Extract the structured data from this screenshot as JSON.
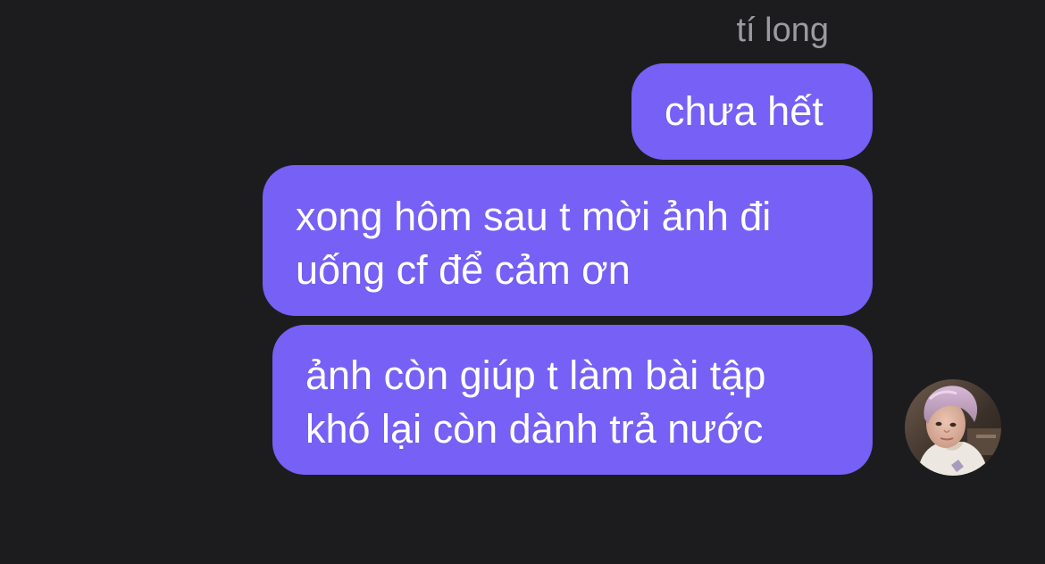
{
  "thread": {
    "sender_name": "tí long",
    "messages": [
      {
        "lines": [
          "chưa hết"
        ]
      },
      {
        "lines": [
          "xong hôm sau t mời ảnh đi",
          "uống cf để cảm ơn"
        ]
      },
      {
        "lines": [
          "ảnh còn giúp t làm bài tập",
          "khó lại còn dành trả nước"
        ]
      }
    ]
  },
  "colors": {
    "background": "#1c1c1e",
    "bubble": "#7660f5",
    "bubble_text": "#ffffff",
    "sender_name": "#9b9b9f"
  },
  "avatar": {
    "icon": "user-avatar-photo"
  }
}
